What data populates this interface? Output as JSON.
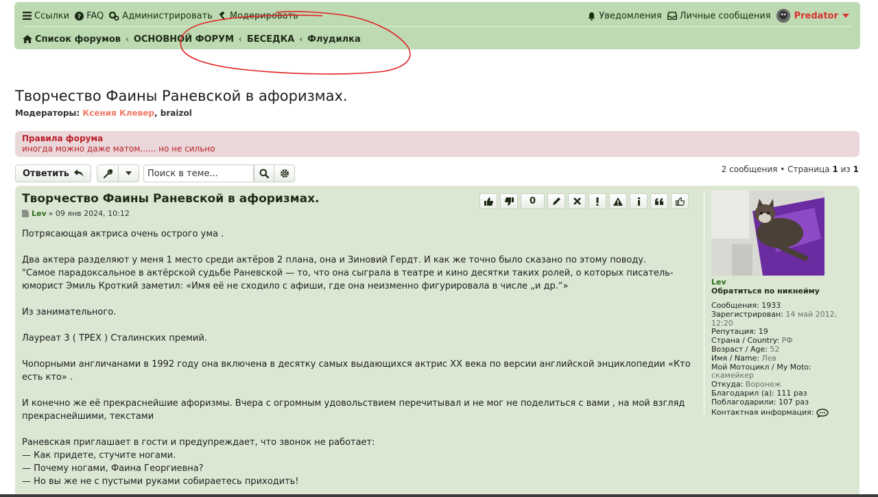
{
  "nav": {
    "links": "Ссылки",
    "faq": "FAQ",
    "admin": "Администрировать",
    "moderate": "Модерировать",
    "notifications": "Уведомления",
    "messages": "Личные сообщения",
    "username": "Predator"
  },
  "breadcrumbs": [
    "Список форумов",
    "ОСНОВНОЙ ФОРУМ",
    "БЕСЕДКА",
    "Флудилка"
  ],
  "topic": {
    "title": "Творчество Фаины Раневской в афоризмах.",
    "moderators_label": "Модераторы:",
    "moderator_1": "Ксения Клевер",
    "moderator_2": "braizol"
  },
  "rules": {
    "title": "Правила форума",
    "text": "иногда можно даже матом...... но не сильно"
  },
  "actions": {
    "reply": "Ответить",
    "search_placeholder": "Поиск в теме..."
  },
  "pagination": {
    "count": "2 сообщения",
    "page_label": "Страница",
    "current": "1",
    "of": "из",
    "total": "1"
  },
  "post": {
    "title": "Творчество Фаины Раневской в афоризмах.",
    "author": "Lev",
    "date": "» 09 янв 2024, 10:12",
    "like_count": "0",
    "paragraphs": [
      "Потрясающая актриса очень острого ума .",
      "Два актера разделяют у меня 1 место среди актёров 2 плана, она и Зиновий Гердт. И как же точно было сказано по этому поводу.\n\"Самое парадоксальное в актёрской судьбе Раневской — то, что она сыграла в театре и кино десятки таких ролей, о которых писатель-юморист Эмиль Кроткий заметил: «Имя её не сходило с афиши, где она неизменно фигурировала в числе „и др.“»",
      "Из занимательного.",
      "Лауреат 3 ( ТРЕХ ) Сталинских премий.",
      "Чопорными англичанами в 1992 году она включена в десятку самых выдающихся актрис XX века по версии английской энциклопедии «Кто есть кто» .",
      "И конечно же её прекраснейшие афоризмы. Вчера с огромным удовольствием перечитывал и не мог не поделиться с вами , на мой взгляд прекраснейшими, текстами",
      "Раневская приглашает в гости и предупреждает, что звонок не работает:\n— Как придете, стучите ногами.\n— Почему ногами, Фаина Георгиевна?\n— Но вы же не с пустыми руками собираетесь приходить!"
    ]
  },
  "profile": {
    "username": "Lev",
    "contact_by_nick": "Обратиться по никнейму",
    "posts_label": "Сообщения:",
    "posts": "1933",
    "registered_label": "Зарегистрирован:",
    "registered": "14 май 2012, 12:20",
    "reputation_label": "Репутация:",
    "reputation": "19",
    "country_label": "Страна / Country:",
    "country": "РФ",
    "age_label": "Возраст / Age:",
    "age": "52",
    "name_label": "Имя / Name:",
    "name": "Лев",
    "moto_label": "Мой Мотоцикл / My Moto:",
    "moto": "скамейкер",
    "from_label": "Откуда:",
    "from": "Воронеж",
    "thanked_label": "Благодарил (а):",
    "thanked": "111 раз",
    "was_thanked_label": "Поблагодарили:",
    "was_thanked": "107 раз",
    "contact_label": "Контактная информация:"
  },
  "colors": {
    "nav_bg": "#bedab3",
    "post_bg": "#dbe7d3",
    "rules_bg": "#ead7d9",
    "rules_text": "#ba1f2b",
    "username": "#d8322c",
    "annotation": "#e02020"
  }
}
